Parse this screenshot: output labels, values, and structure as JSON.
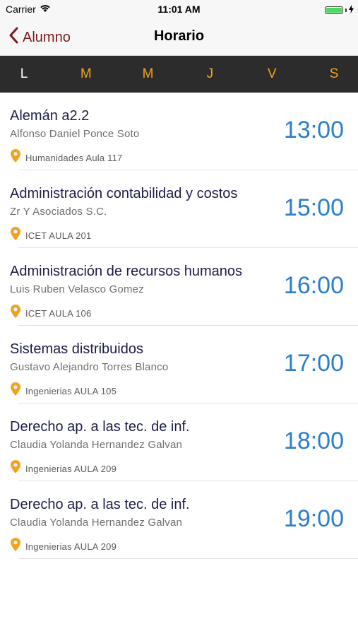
{
  "status": {
    "carrier": "Carrier",
    "time": "11:01 AM"
  },
  "nav": {
    "back_label": "Alumno",
    "title": "Horario"
  },
  "days": [
    "L",
    "M",
    "M",
    "J",
    "V",
    "S"
  ],
  "active_day": "L",
  "colors": {
    "accent_orange": "#f2a21c",
    "time_blue": "#2b7fcf",
    "back_red": "#7a1c1c",
    "tabbar_dark": "#2c2c2c"
  },
  "schedule": [
    {
      "course": "Alemán a2.2",
      "teacher": "Alfonso Daniel Ponce Soto",
      "time": "13:00",
      "location": "Humanidades Aula 117"
    },
    {
      "course": "Administración contabilidad y costos",
      "teacher": "Zr Y Asociados S.C.",
      "time": "15:00",
      "location": "ICET AULA 201"
    },
    {
      "course": "Administración de recursos humanos",
      "teacher": "Luis Ruben Velasco Gomez",
      "time": "16:00",
      "location": "ICET AULA 106"
    },
    {
      "course": "Sistemas distribuidos",
      "teacher": "Gustavo Alejandro Torres Blanco",
      "time": "17:00",
      "location": "Ingenierias AULA 105"
    },
    {
      "course": "Derecho ap. a las tec. de inf.",
      "teacher": "Claudia Yolanda Hernandez Galvan",
      "time": "18:00",
      "location": "Ingenierias AULA 209"
    },
    {
      "course": "Derecho ap. a las tec. de inf.",
      "teacher": "Claudia Yolanda Hernandez Galvan",
      "time": "19:00",
      "location": "Ingenierias AULA 209"
    }
  ]
}
